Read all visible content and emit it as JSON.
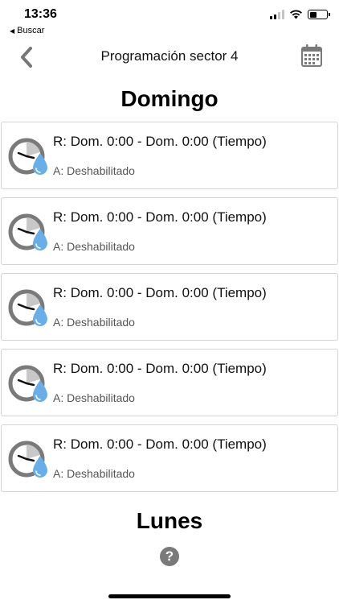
{
  "status_bar": {
    "time": "13:36",
    "back_app": "Buscar",
    "icons": [
      "signal-icon",
      "wifi-icon",
      "battery-icon"
    ]
  },
  "nav": {
    "back_icon": "chevron-left-icon",
    "title": "Programación sector 4",
    "calendar_icon": "calendar-icon"
  },
  "days": [
    {
      "name": "Domingo",
      "entries": [
        {
          "range": "R: Dom. 0:00 - Dom. 0:00 (Tiempo)",
          "status": "A: Deshabilitado"
        },
        {
          "range": "R: Dom. 0:00 - Dom. 0:00 (Tiempo)",
          "status": "A: Deshabilitado"
        },
        {
          "range": "R: Dom. 0:00 - Dom. 0:00 (Tiempo)",
          "status": "A: Deshabilitado"
        },
        {
          "range": "R: Dom. 0:00 - Dom. 0:00 (Tiempo)",
          "status": "A: Deshabilitado"
        },
        {
          "range": "R: Dom. 0:00 - Dom. 0:00 (Tiempo)",
          "status": "A: Deshabilitado"
        }
      ]
    },
    {
      "name": "Lunes",
      "entries": []
    }
  ],
  "help_icon": "question-circle-icon",
  "help_glyph": "?",
  "colors": {
    "water_drop": "#6aaee8",
    "clock_gray": "#7a7a7a",
    "card_border": "#d4d4d4"
  }
}
